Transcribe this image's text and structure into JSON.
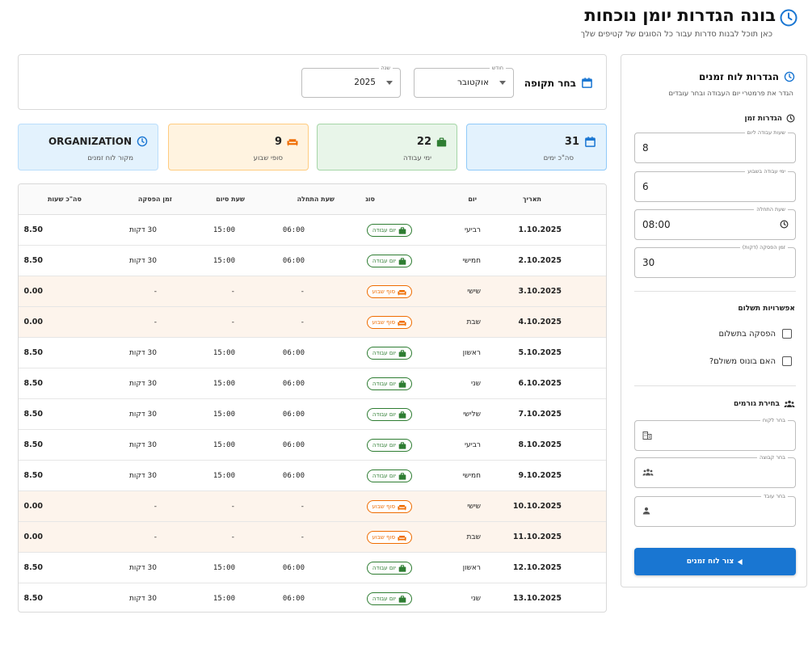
{
  "header": {
    "title": "בונה הגדרות יומן נוכחות",
    "subtitle": "כאן תוכל לבנות סדרות עבור כל הסוגים של קטיפים שלך"
  },
  "settings": {
    "title": "הגדרות לוח זמנים",
    "subtitle": "הגדר את פרמטרי יום העבודה ובחר עובדים",
    "time_section": "הגדרות זמן",
    "fields": [
      {
        "label": "שעות עבודה ליום",
        "value": "8"
      },
      {
        "label": "ימי עבודה בשבוע",
        "value": "6"
      },
      {
        "label": "שעת התחלה",
        "value": "08:00"
      },
      {
        "label": "זמן הפסקה (דקות)",
        "value": "30"
      }
    ],
    "payment_section": "אפשרויות תשלום",
    "checkboxes": [
      {
        "label": "הפסקה בתשלום"
      },
      {
        "label": "האם בונוס משולם?"
      }
    ],
    "entities_section": "בחירת גורמים",
    "selects": [
      {
        "label": "בחר לקוח",
        "icon": "business-icon"
      },
      {
        "label": "בחר קבוצה",
        "icon": "groups-icon"
      },
      {
        "label": "בחר עובד",
        "icon": "person-icon"
      }
    ],
    "create_button": "צור לוח זמנים"
  },
  "period": {
    "label": "בחר תקופה",
    "month_label": "חודש",
    "month_value": "אוקטובר",
    "year_label": "שנה",
    "year_value": "2025"
  },
  "summary": [
    {
      "value": "31",
      "label": "סה\"כ ימים",
      "icon": "calendar-icon"
    },
    {
      "value": "22",
      "label": "ימי עבודה",
      "icon": "briefcase-icon"
    },
    {
      "value": "9",
      "label": "סופי שבוע",
      "icon": "sofa-icon"
    },
    {
      "value": "ORGANIZATION",
      "label": "מקור לוח זמנים",
      "icon": "clock-icon"
    }
  ],
  "colors": {
    "primary": "#1976d2",
    "work": "#2e7d32",
    "weekend": "#ef6c00",
    "card_total_bg": "#e3f2fd",
    "card_work_bg": "#e8f5e9",
    "card_weekend_bg": "#fff3e0",
    "weekend_row_bg": "#fdf4ec"
  },
  "table": {
    "headers": {
      "date": "תאריך",
      "day": "יום",
      "type": "סוג",
      "start": "שעת התחלה",
      "end": "שעת סיום",
      "break": "זמן הפסקה",
      "total": "סה\"כ שעות"
    },
    "rows": [
      {
        "date": "1.10.2025",
        "day": "רביעי",
        "type": "יום עבודה",
        "kind": "work",
        "start": "06:00",
        "end": "15:00",
        "break": "30 דקות",
        "total": "8.50"
      },
      {
        "date": "2.10.2025",
        "day": "חמישי",
        "type": "יום עבודה",
        "kind": "work",
        "start": "06:00",
        "end": "15:00",
        "break": "30 דקות",
        "total": "8.50"
      },
      {
        "date": "3.10.2025",
        "day": "שישי",
        "type": "סוף שבוע",
        "kind": "weekend",
        "start": "-",
        "end": "-",
        "break": "-",
        "total": "0.00"
      },
      {
        "date": "4.10.2025",
        "day": "שבת",
        "type": "סוף שבוע",
        "kind": "weekend",
        "start": "-",
        "end": "-",
        "break": "-",
        "total": "0.00"
      },
      {
        "date": "5.10.2025",
        "day": "ראשון",
        "type": "יום עבודה",
        "kind": "work",
        "start": "06:00",
        "end": "15:00",
        "break": "30 דקות",
        "total": "8.50"
      },
      {
        "date": "6.10.2025",
        "day": "שני",
        "type": "יום עבודה",
        "kind": "work",
        "start": "06:00",
        "end": "15:00",
        "break": "30 דקות",
        "total": "8.50"
      },
      {
        "date": "7.10.2025",
        "day": "שלישי",
        "type": "יום עבודה",
        "kind": "work",
        "start": "06:00",
        "end": "15:00",
        "break": "30 דקות",
        "total": "8.50"
      },
      {
        "date": "8.10.2025",
        "day": "רביעי",
        "type": "יום עבודה",
        "kind": "work",
        "start": "06:00",
        "end": "15:00",
        "break": "30 דקות",
        "total": "8.50"
      },
      {
        "date": "9.10.2025",
        "day": "חמישי",
        "type": "יום עבודה",
        "kind": "work",
        "start": "06:00",
        "end": "15:00",
        "break": "30 דקות",
        "total": "8.50"
      },
      {
        "date": "10.10.2025",
        "day": "שישי",
        "type": "סוף שבוע",
        "kind": "weekend",
        "start": "-",
        "end": "-",
        "break": "-",
        "total": "0.00"
      },
      {
        "date": "11.10.2025",
        "day": "שבת",
        "type": "סוף שבוע",
        "kind": "weekend",
        "start": "-",
        "end": "-",
        "break": "-",
        "total": "0.00"
      },
      {
        "date": "12.10.2025",
        "day": "ראשון",
        "type": "יום עבודה",
        "kind": "work",
        "start": "06:00",
        "end": "15:00",
        "break": "30 דקות",
        "total": "8.50"
      },
      {
        "date": "13.10.2025",
        "day": "שני",
        "type": "יום עבודה",
        "kind": "work",
        "start": "06:00",
        "end": "15:00",
        "break": "30 דקות",
        "total": "8.50"
      }
    ]
  }
}
